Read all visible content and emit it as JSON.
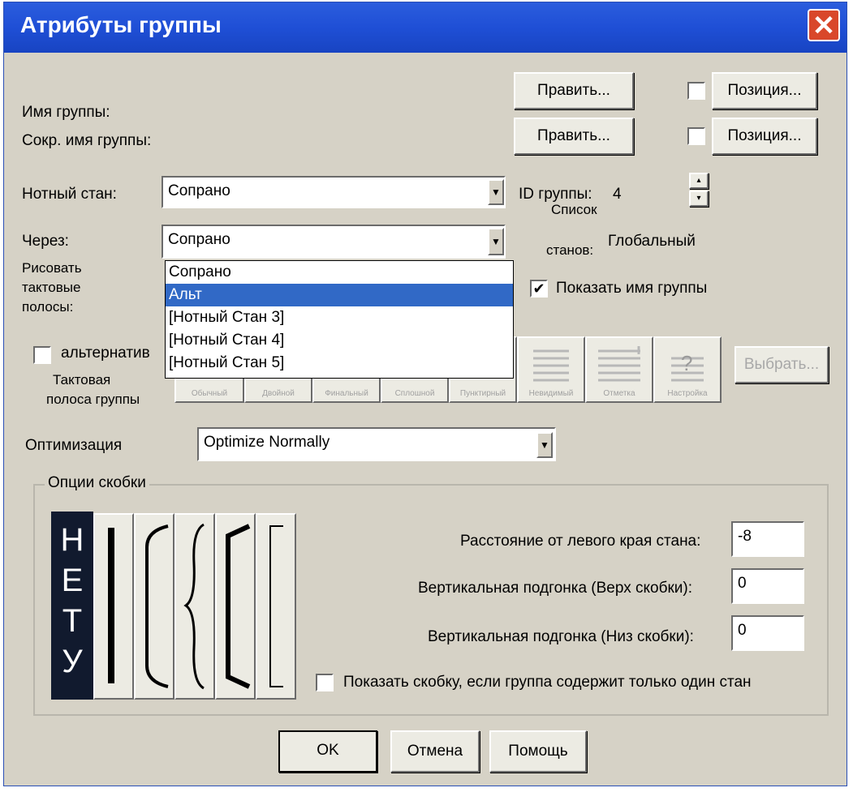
{
  "window": {
    "title": "Атрибуты группы",
    "close": "✕"
  },
  "group_name": {
    "label": "Имя группы:",
    "edit_button": "Править...",
    "position_button": "Позиция..."
  },
  "short_name": {
    "label": "Сокр. имя группы:",
    "edit_button": "Править...",
    "position_button": "Позиция..."
  },
  "staff": {
    "label": "Нотный стан:",
    "value": "Сопрано"
  },
  "through": {
    "label": "Через:",
    "value": "Сопрано"
  },
  "group_id": {
    "label": "ID группы:",
    "value": "4"
  },
  "staff_list": {
    "label_line1": "Список",
    "label_line2": "станов:",
    "value": "Глобальный"
  },
  "draw_barlines": {
    "line1": "Рисовать",
    "line2": "тактовые",
    "line3": "полосы:"
  },
  "dropdown_options": [
    "Сопрано",
    "Альт",
    "[Нотный Стан 3]",
    "[Нотный Стан 4]",
    "[Нотный Стан 5]"
  ],
  "show_group_name": {
    "label": "Показать имя группы",
    "checked": true
  },
  "alternative": {
    "label": "альтернатив"
  },
  "group_barline": {
    "line1": "Тактовая",
    "line2": "полоса группы"
  },
  "barline_buttons": [
    "Обычный",
    "Двойной",
    "Финальный",
    "Сплошной",
    "Пунктирный",
    "Невидимый",
    "Отметка",
    "Настройка"
  ],
  "choose_button": "Выбрать...",
  "optimization": {
    "label": "Оптимизация",
    "value": "Optimize Normally"
  },
  "bracket_options": {
    "caption": "Опции скобки",
    "none_letters": [
      "Н",
      "Е",
      "Т",
      "У"
    ],
    "distance_label": "Расстояние от левого края стана:",
    "distance_value": "-8",
    "vtop_label": "Вертикальная подгонка (Верх скобки):",
    "vtop_value": "0",
    "vbottom_label": "Вертикальная подгонка (Низ скобки):",
    "vbottom_value": "0",
    "single_staff_label": "Показать скобку, если группа содержит только один стан"
  },
  "buttons": {
    "ok": "OK",
    "cancel": "Отмена",
    "help": "Помощь"
  }
}
